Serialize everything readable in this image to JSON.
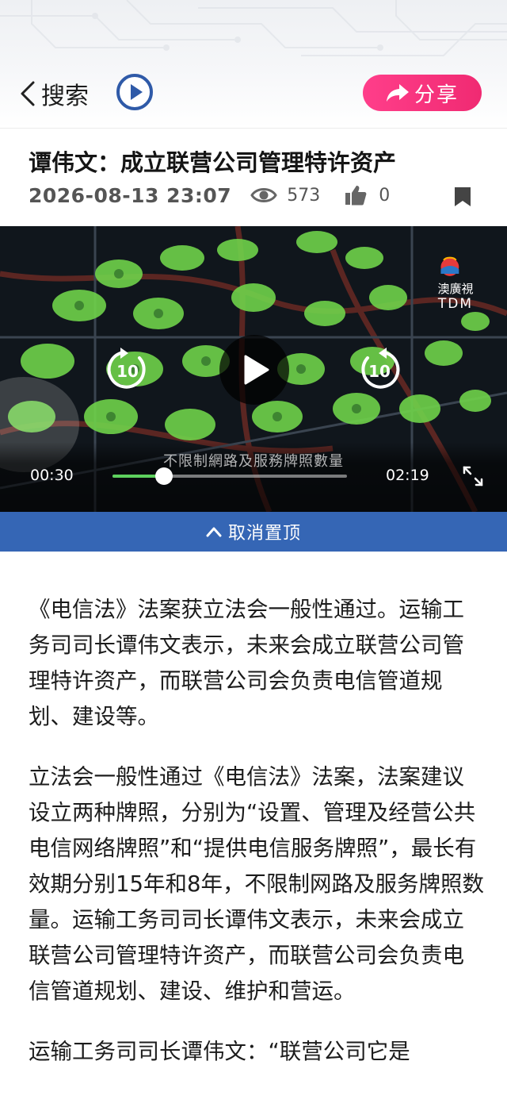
{
  "header": {
    "back_label": "搜索",
    "back_icon": "chevron-left-icon",
    "play_icon": "play-circle-icon",
    "share_label": "分享",
    "share_icon": "share-arrow-icon",
    "colors": {
      "share_bg": "#f02a72",
      "play_ring": "#2f5aa8"
    }
  },
  "article_header": {
    "title": "谭伟文：成立联营公司管理特许资产",
    "date": "2026-08-13 23:07",
    "views": "573",
    "likes": "0",
    "icons": {
      "views": "eye-icon",
      "likes": "thumbs-up-icon",
      "bookmark": "bookmark-icon"
    }
  },
  "video": {
    "logo_text": "澳廣視",
    "logo_sub": "TDM",
    "subtitle": "不限制網路及服務牌照數量",
    "current_time": "00:30",
    "total_time": "02:19",
    "progress": 0.22,
    "rewind_seconds": "10",
    "forward_seconds": "10",
    "progress_color": "#5dd05d"
  },
  "pin_bar": {
    "label": "取消置顶",
    "icon": "chevron-up-icon",
    "color": "#3566b5"
  },
  "article": {
    "paragraphs": [
      "《电信法》法案获立法会一般性通过。运输工务司司长谭伟文表示，未来会成立联营公司管理特许资产，而联营公司会负责电信管道规划、建设等。",
      "立法会一般性通过《电信法》法案，法案建议设立两种牌照，分别为“设置、管理及经营公共电信网络牌照”和“提供电信服务牌照”，最长有效期分别15年和8年，不限制网路及服务牌照数量。运输工务司司长谭伟文表示，未来会成立联营公司管理特许资产，而联营公司会负责电信管道规划、建设、维护和营运。",
      "运输工务司司长谭伟文：“联营公司它是"
    ]
  }
}
